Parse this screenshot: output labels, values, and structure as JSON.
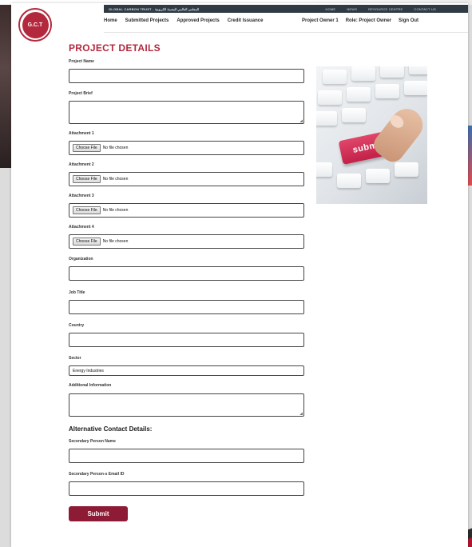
{
  "header": {
    "brand": "GLOBAL CARBON TRUST - المجلس العالمي للبصمة الكربونية",
    "utility_links": [
      "HOME",
      "NEWS",
      "RESOURCE CENTRE",
      "CONTACT US"
    ],
    "logo_text": "G.C.T",
    "nav": [
      "Home",
      "Submitted Projects",
      "Approved Projects",
      "Credit Issuance"
    ],
    "user": [
      "Project Owner 1",
      "Role: Project Owner",
      "Sign Out"
    ]
  },
  "form": {
    "title": "PROJECT DETAILS",
    "project_name_label": "Project Name",
    "project_brief_label": "Project Brief",
    "attachments": [
      {
        "label": "Attachment 1",
        "button": "Choose File",
        "status": "No file chosen"
      },
      {
        "label": "Attachment 2",
        "button": "Choose File",
        "status": "No file chosen"
      },
      {
        "label": "Attachment 3",
        "button": "Choose File",
        "status": "No file chosen"
      },
      {
        "label": "Attachment 4",
        "button": "Choose File",
        "status": "No file chosen"
      }
    ],
    "organization_label": "Organization",
    "job_title_label": "Job Title",
    "country_label": "Country",
    "sector_label": "Sector",
    "sector_value": "Energy Industries",
    "additional_info_label": "Additional Information",
    "alt_contact_heading": "Alternative Contact Details:",
    "secondary_name_label": "Secondary Person Name",
    "secondary_email_label": "Secondary Person-s Email ID",
    "submit_label": "Submit"
  },
  "illustration": {
    "key_text": "submit"
  },
  "colors": {
    "accent": "#b3283d",
    "submit_button": "#8e1b35",
    "topbar": "#2f3a44"
  }
}
